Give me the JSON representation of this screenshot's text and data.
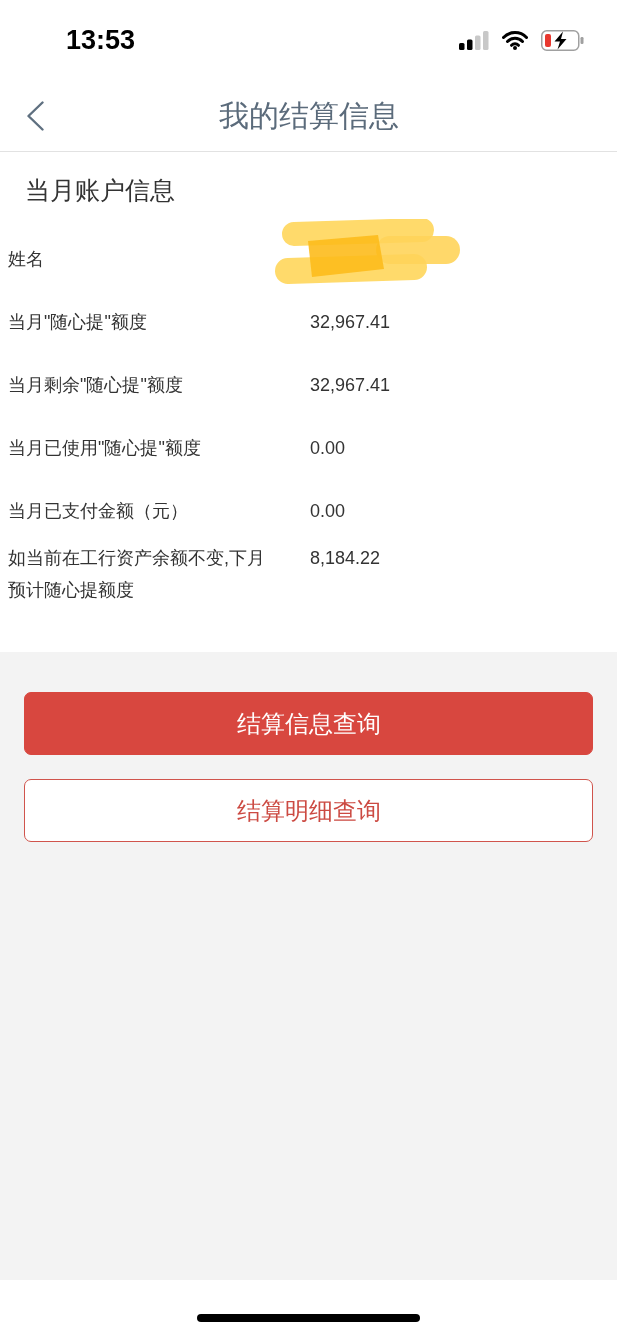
{
  "status_bar": {
    "time": "13:53"
  },
  "header": {
    "title": "我的结算信息"
  },
  "section": {
    "title": "当月账户信息"
  },
  "account_rows": [
    {
      "kind": "redacted",
      "label": "姓名"
    },
    {
      "kind": "amount",
      "label": "当月\"随心提\"额度",
      "value": "32,967.41"
    },
    {
      "kind": "amount",
      "label": "当月剩余\"随心提\"额度",
      "value": "32,967.41"
    },
    {
      "kind": "amount",
      "label": "当月已使用\"随心提\"额度",
      "value": "0.00"
    },
    {
      "kind": "amount",
      "label": "当月已支付金额（元）",
      "value": "0.00"
    },
    {
      "kind": "amount",
      "label": "如当前在工行资产余额不变,下月预计随心提额度",
      "value": "8,184.22"
    }
  ],
  "buttons": [
    {
      "label": "结算信息查询",
      "kind": "primary"
    },
    {
      "label": "结算明细查询",
      "kind": "outline"
    }
  ]
}
